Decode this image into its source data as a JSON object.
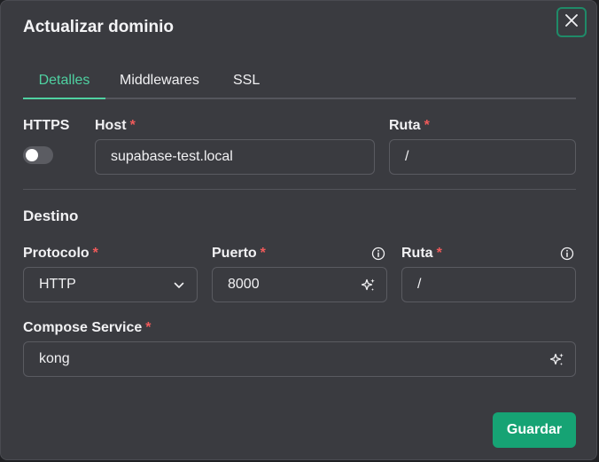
{
  "dialog": {
    "title": "Actualizar dominio",
    "close_icon": "close-icon"
  },
  "tabs": [
    {
      "label": "Detalles",
      "active": true
    },
    {
      "label": "Middlewares",
      "active": false
    },
    {
      "label": "SSL",
      "active": false
    }
  ],
  "details": {
    "https_label": "HTTPS",
    "https_enabled": false,
    "host": {
      "label": "Host",
      "required": "*",
      "value": "supabase-test.local"
    },
    "path": {
      "label": "Ruta",
      "required": "*",
      "value": "/"
    }
  },
  "destination": {
    "title": "Destino",
    "protocol": {
      "label": "Protocolo",
      "required": "*",
      "value": "HTTP"
    },
    "port": {
      "label": "Puerto",
      "required": "*",
      "value": "8000"
    },
    "path": {
      "label": "Ruta",
      "required": "*",
      "value": "/"
    },
    "compose_service": {
      "label": "Compose Service",
      "required": "*",
      "value": "kong"
    }
  },
  "actions": {
    "save_label": "Guardar"
  },
  "colors": {
    "accent": "#4fd1a1",
    "primary_button": "#16a374",
    "required": "#f05a5a"
  }
}
